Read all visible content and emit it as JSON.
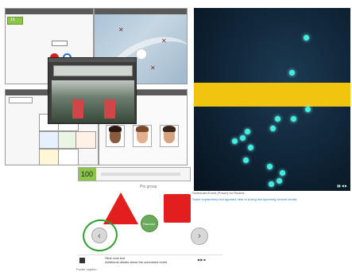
{
  "panels": {
    "top_left_title": "",
    "score_top": "15",
    "score_counter": "100",
    "counter_label": ""
  },
  "dark_video": {
    "caption": "",
    "corner_controls": "▮▮ ◀ ▶"
  },
  "slide": {
    "title": "Pin group",
    "center_button_label": "Random",
    "side_text_title": "Scheduled Event (Power) for Review",
    "side_text_body": "Some explanatory text appears here in a long line spanning several words.",
    "footer_left": "Footer caption",
    "footer_line_1": "Slide note text",
    "footer_line_2": "Additional details about the scheduled event",
    "footer_right": "◀ ▶ ■"
  },
  "colors": {
    "accent_green": "#8cc34a",
    "shape_red": "#e31e1e",
    "ring_green": "#2fa02f",
    "dot_cyan": "#3ff0e0",
    "yellow_band": "#f1c40f"
  },
  "icons": [
    "prev-arrow-icon",
    "next-arrow-icon",
    "play-icon"
  ]
}
